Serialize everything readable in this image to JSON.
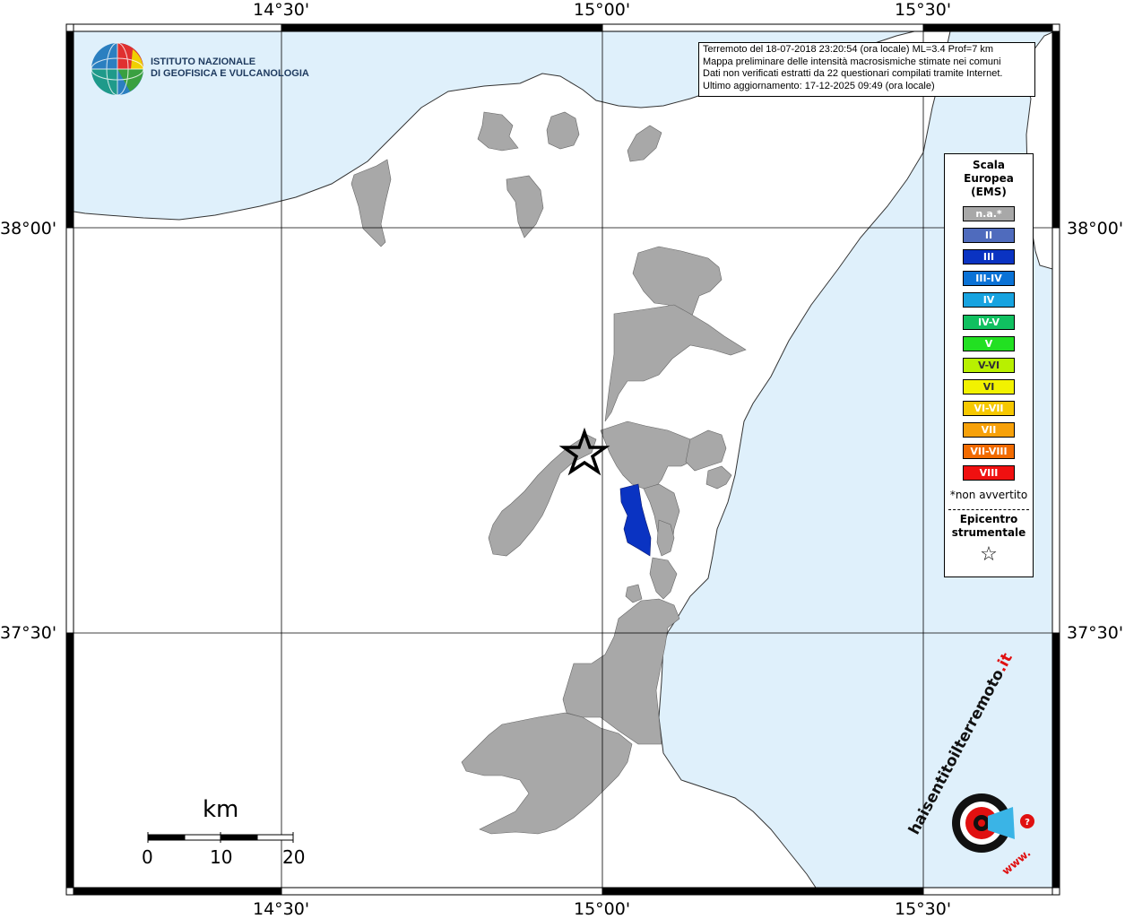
{
  "map": {
    "lon_ticks_top": [
      "14°30'",
      "15°00'",
      "15°30'"
    ],
    "lon_ticks_bottom": [
      "14°30'",
      "15°00'",
      "15°30'"
    ],
    "lat_ticks_left": [
      "38°00'",
      "37°30'"
    ],
    "lat_ticks_right": [
      "38°00'",
      "37°30'"
    ],
    "sea_color": "#dff0fb",
    "land_color": "#ffffff",
    "municipality_color": "#a8a8a8",
    "intensity_iii_color": "#0a33c2",
    "epicenter_symbol": "star-icon"
  },
  "logo": {
    "line1": "ISTITUTO NAZIONALE",
    "line2": "DI GEOFISICA E VULCANOLOGIA",
    "icon": "ingv-globe-icon"
  },
  "info": {
    "line1": "Terremoto del 18-07-2018 23:20:54 (ora locale) ML=3.4 Prof=7 km",
    "line2": "Mappa preliminare delle intensità macrosismiche stimate nei comuni",
    "line3": "Dati non verificati estratti da 22 questionari compilati tramite Internet.",
    "line4": "Ultimo aggiornamento: 17-12-2025 09:49 (ora locale)"
  },
  "legend": {
    "title1": "Scala",
    "title2": "Europea",
    "title3": "(EMS)",
    "items": [
      {
        "label": "n.a.*",
        "color": "#a8a8a8"
      },
      {
        "label": "II",
        "color": "#4f6bbd"
      },
      {
        "label": "III",
        "color": "#0a33c2"
      },
      {
        "label": "III-IV",
        "color": "#0a72d6"
      },
      {
        "label": "IV",
        "color": "#17a3e0"
      },
      {
        "label": "IV-V",
        "color": "#10c060"
      },
      {
        "label": "V",
        "color": "#22e022"
      },
      {
        "label": "V-VI",
        "color": "#b8f000"
      },
      {
        "label": "VI",
        "color": "#f2f200"
      },
      {
        "label": "VI-VII",
        "color": "#f6c800"
      },
      {
        "label": "VII",
        "color": "#f7a10a"
      },
      {
        "label": "VII-VIII",
        "color": "#f26b00"
      },
      {
        "label": "VIII",
        "color": "#f01010"
      }
    ],
    "note": "*non avvertito",
    "epicenter1": "Epicentro",
    "epicenter2": "strumentale",
    "epicenter_icon": "star-outline-icon"
  },
  "scalebar": {
    "unit": "km",
    "labels": [
      "0",
      "10",
      "20"
    ]
  },
  "brand": {
    "text_main": "haisentitoilterremoto",
    "text_suffix": ".it",
    "prefix": "www.",
    "icon": "seismometer-logo-icon"
  }
}
